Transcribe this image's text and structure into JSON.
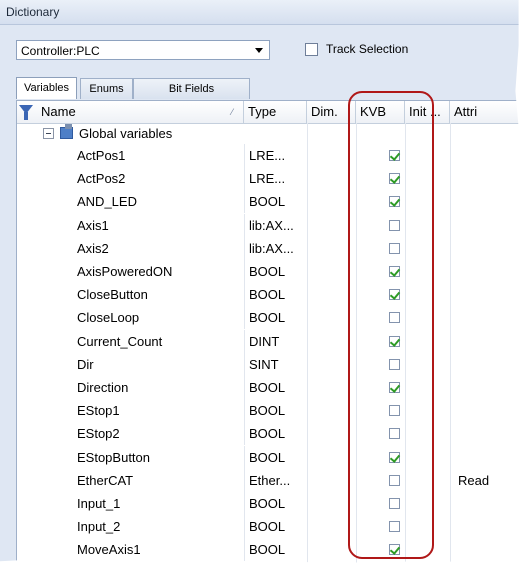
{
  "window": {
    "title": "Dictionary"
  },
  "toolbar": {
    "controller_value": "Controller:PLC",
    "track_selection_label": "Track Selection",
    "track_selection_checked": false
  },
  "tabs": [
    {
      "label": "Variables",
      "active": true
    },
    {
      "label": "Enums",
      "active": false
    },
    {
      "label": "Bit Fields",
      "active": false
    }
  ],
  "grid": {
    "columns": [
      "Name",
      "Type",
      "Dim.",
      "KVB",
      "Init ...",
      "Attri"
    ],
    "group_label": "Global variables",
    "rows": [
      {
        "name": "ActPos1",
        "type": "LRE...",
        "kvb": true,
        "attr": ""
      },
      {
        "name": "ActPos2",
        "type": "LRE...",
        "kvb": true,
        "attr": ""
      },
      {
        "name": "AND_LED",
        "type": "BOOL",
        "kvb": true,
        "attr": ""
      },
      {
        "name": "Axis1",
        "type": "lib:AX...",
        "kvb": false,
        "attr": ""
      },
      {
        "name": "Axis2",
        "type": "lib:AX...",
        "kvb": false,
        "attr": ""
      },
      {
        "name": "AxisPoweredON",
        "type": "BOOL",
        "kvb": true,
        "attr": ""
      },
      {
        "name": "CloseButton",
        "type": "BOOL",
        "kvb": true,
        "attr": ""
      },
      {
        "name": "CloseLoop",
        "type": "BOOL",
        "kvb": false,
        "attr": ""
      },
      {
        "name": "Current_Count",
        "type": "DINT",
        "kvb": true,
        "attr": ""
      },
      {
        "name": "Dir",
        "type": "SINT",
        "kvb": false,
        "attr": ""
      },
      {
        "name": "Direction",
        "type": "BOOL",
        "kvb": true,
        "attr": ""
      },
      {
        "name": "EStop1",
        "type": "BOOL",
        "kvb": false,
        "attr": ""
      },
      {
        "name": "EStop2",
        "type": "BOOL",
        "kvb": false,
        "attr": ""
      },
      {
        "name": "EStopButton",
        "type": "BOOL",
        "kvb": true,
        "attr": ""
      },
      {
        "name": "EtherCAT",
        "type": "Ether...",
        "kvb": false,
        "attr": "Read"
      },
      {
        "name": "Input_1",
        "type": "BOOL",
        "kvb": false,
        "attr": ""
      },
      {
        "name": "Input_2",
        "type": "BOOL",
        "kvb": false,
        "attr": ""
      },
      {
        "name": "MoveAxis1",
        "type": "BOOL",
        "kvb": true,
        "attr": ""
      }
    ]
  },
  "colors": {
    "highlight": "#b01818",
    "checkmark": "#2e9b25",
    "panel_bg": "#dfe7f3"
  }
}
